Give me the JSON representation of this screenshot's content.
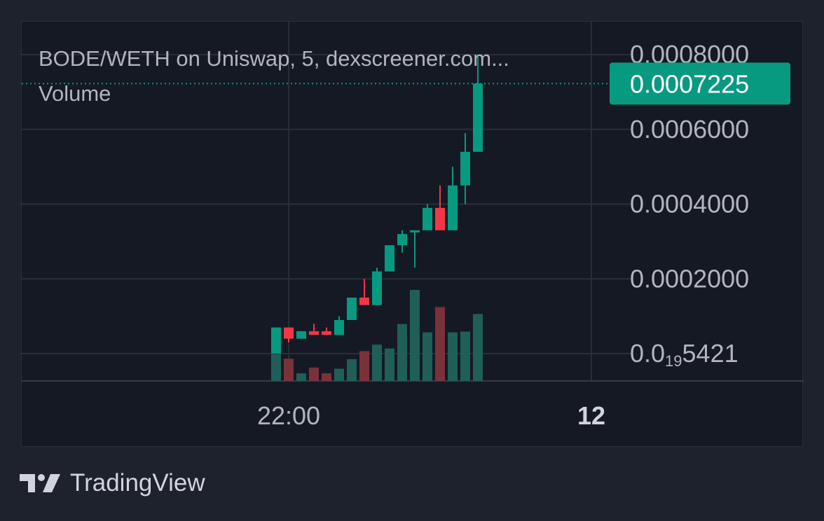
{
  "chart_data": {
    "type": "candlestick",
    "legend": {
      "title": "BODE/WETH on Uniswap, 5, dexscreener.com...",
      "volume_label": "Volume"
    },
    "y_axis": {
      "ticks": [
        {
          "value": 0.0008,
          "label": "0.0008000"
        },
        {
          "value": 0.0006,
          "label": "0.0006000"
        },
        {
          "value": 0.0004,
          "label": "0.0004000"
        },
        {
          "value": 0.0002,
          "label": "0.0002000"
        }
      ],
      "bottom_label": "0.0",
      "bottom_label_sub": "19",
      "bottom_label_tail": "5421",
      "range": [
        0.0,
        0.00087
      ]
    },
    "current_price": {
      "value": 0.0007225,
      "label": "0.0007225",
      "color": "#089981"
    },
    "x_axis": {
      "ticks": [
        {
          "index": 1,
          "label": "22:00",
          "bold": false
        },
        {
          "index": 25,
          "label": "12",
          "bold": true
        }
      ]
    },
    "colors": {
      "up": "#089981",
      "down": "#f23645",
      "vol_up": "#1f5f57",
      "vol_down": "#7a323a",
      "grid": "#2a2e39"
    },
    "candles": [
      {
        "o": 0.0,
        "h": 7e-05,
        "l": 0.0,
        "c": 7e-05,
        "v": 0.07
      },
      {
        "o": 7e-05,
        "h": 7e-05,
        "l": 3e-05,
        "c": 4e-05,
        "v": 0.058
      },
      {
        "o": 4e-05,
        "h": 6e-05,
        "l": 4e-05,
        "c": 6e-05,
        "v": 0.02
      },
      {
        "o": 6e-05,
        "h": 8e-05,
        "l": 5e-05,
        "c": 5e-05,
        "v": 0.035
      },
      {
        "o": 6e-05,
        "h": 7e-05,
        "l": 5e-05,
        "c": 5e-05,
        "v": 0.02
      },
      {
        "o": 5e-05,
        "h": 0.0001,
        "l": 5e-05,
        "c": 9e-05,
        "v": 0.032
      },
      {
        "o": 9e-05,
        "h": 0.00015,
        "l": 9e-05,
        "c": 0.00015,
        "v": 0.057
      },
      {
        "o": 0.00015,
        "h": 0.0002,
        "l": 0.00013,
        "c": 0.00013,
        "v": 0.078
      },
      {
        "o": 0.00013,
        "h": 0.00023,
        "l": 0.00013,
        "c": 0.00022,
        "v": 0.095
      },
      {
        "o": 0.00022,
        "h": 0.00029,
        "l": 0.00022,
        "c": 0.00029,
        "v": 0.085
      },
      {
        "o": 0.00029,
        "h": 0.00033,
        "l": 0.00027,
        "c": 0.00032,
        "v": 0.149
      },
      {
        "o": 0.00033,
        "h": 0.00033,
        "l": 0.00023,
        "c": 0.00033,
        "v": 0.238
      },
      {
        "o": 0.00033,
        "h": 0.0004,
        "l": 0.00033,
        "c": 0.00039,
        "v": 0.127
      },
      {
        "o": 0.00039,
        "h": 0.00045,
        "l": 0.00033,
        "c": 0.00033,
        "v": 0.193
      },
      {
        "o": 0.00033,
        "h": 0.0005,
        "l": 0.00033,
        "c": 0.00045,
        "v": 0.127
      },
      {
        "o": 0.00045,
        "h": 0.00059,
        "l": 0.0004,
        "c": 0.00054,
        "v": 0.129
      },
      {
        "o": 0.00054,
        "h": 0.0008,
        "l": 0.00054,
        "c": 0.0007225,
        "v": 0.175
      }
    ],
    "first_candle_index": 0,
    "volume_max_fraction": 0.28
  },
  "branding": {
    "name": "TradingView"
  }
}
